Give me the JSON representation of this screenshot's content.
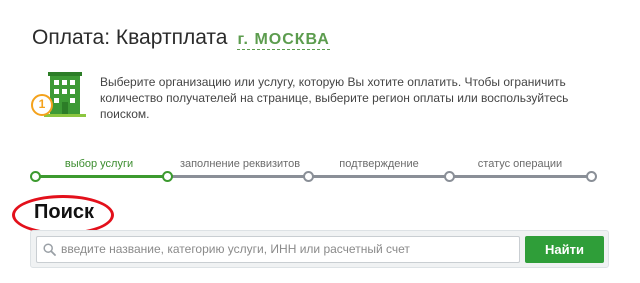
{
  "header": {
    "title": "Оплата: Квартплата",
    "region": "г. МОСКВА"
  },
  "info": {
    "icon": "building-icon",
    "step_number": "1",
    "text": "Выберите организацию или услугу, которую Вы хотите оплатить. Чтобы ограничить количество получателей на странице, выберите регион оплаты или воспользуйтесь поиском."
  },
  "steps": [
    {
      "label": "выбор услуги",
      "active": true
    },
    {
      "label": "заполнение реквизитов",
      "active": false
    },
    {
      "label": "подтверждение",
      "active": false
    },
    {
      "label": "статус операции",
      "active": false
    }
  ],
  "search": {
    "title": "Поиск",
    "placeholder": "введите название, категорию услуги, ИНН или расчетный счет",
    "value": "",
    "button_label": "Найти"
  },
  "colors": {
    "accent_green": "#3c9a2f",
    "button_green": "#2f9e39",
    "annotation_red": "#e3101b"
  }
}
